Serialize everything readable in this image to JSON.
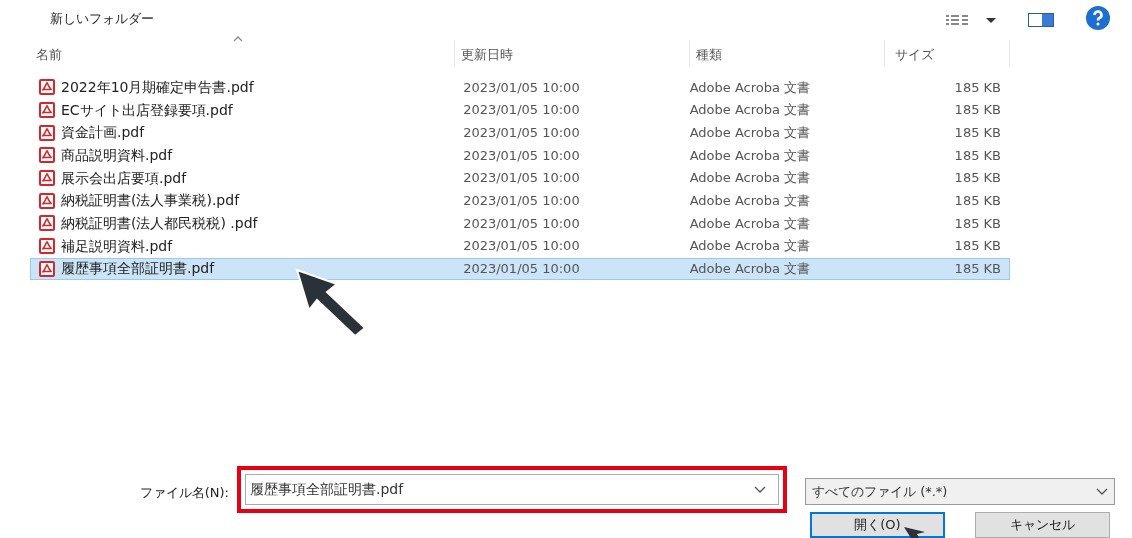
{
  "toolbar": {
    "new_folder": "新しいフォルダー"
  },
  "columns": [
    {
      "label": "名前",
      "sorted": true
    },
    {
      "label": "更新日時",
      "sorted": false
    },
    {
      "label": "種類",
      "sorted": false
    },
    {
      "label": "サイズ",
      "sorted": false
    }
  ],
  "files": [
    {
      "name": "2022年10月期確定申告書.pdf",
      "modified": "2023/01/05 10:00",
      "type": "Adobe Acroba 文書",
      "size": "185 KB",
      "selected": false
    },
    {
      "name": "ECサイト出店登録要項.pdf",
      "modified": "2023/01/05 10:00",
      "type": "Adobe Acroba 文書",
      "size": "185 KB",
      "selected": false
    },
    {
      "name": "資金計画.pdf",
      "modified": "2023/01/05 10:00",
      "type": "Adobe Acroba 文書",
      "size": "185 KB",
      "selected": false
    },
    {
      "name": "商品説明資料.pdf",
      "modified": "2023/01/05 10:00",
      "type": "Adobe Acroba 文書",
      "size": "185 KB",
      "selected": false
    },
    {
      "name": "展示会出店要項.pdf",
      "modified": "2023/01/05 10:00",
      "type": "Adobe Acroba 文書",
      "size": "185 KB",
      "selected": false
    },
    {
      "name": "納税証明書(法人事業税).pdf",
      "modified": "2023/01/05 10:00",
      "type": "Adobe Acroba 文書",
      "size": "185 KB",
      "selected": false
    },
    {
      "name": "納税証明書(法人都民税税) .pdf",
      "modified": "2023/01/05 10:00",
      "type": "Adobe Acroba 文書",
      "size": "185 KB",
      "selected": false
    },
    {
      "name": "補足説明資料.pdf",
      "modified": "2023/01/05 10:00",
      "type": "Adobe Acroba 文書",
      "size": "185 KB",
      "selected": false
    },
    {
      "name": "履歴事項全部証明書.pdf",
      "modified": "2023/01/05 10:00",
      "type": "Adobe Acroba 文書",
      "size": "185 KB",
      "selected": true
    }
  ],
  "filename": {
    "label": "ファイル名(N):",
    "value": "履歴事項全部証明書.pdf",
    "highlighted": true
  },
  "filter": {
    "value": "すべてのファイル (*.*)"
  },
  "buttons": [
    {
      "label": "開く(O)",
      "default": true
    },
    {
      "label": "キャンセル",
      "default": false
    }
  ]
}
